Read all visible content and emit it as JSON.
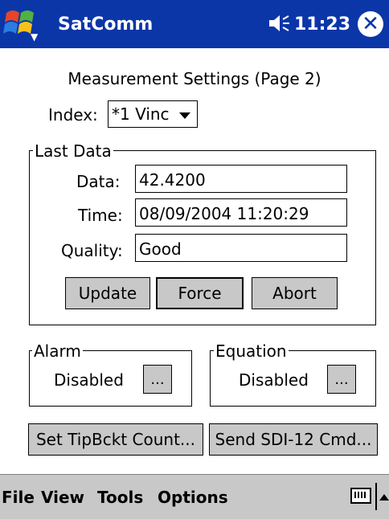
{
  "titlebar": {
    "app_title": "SatComm",
    "time": "11:23",
    "close": "✕"
  },
  "heading": "Measurement Settings (Page 2)",
  "index": {
    "label": "Index:",
    "value": "*1 Vinc"
  },
  "last_data": {
    "legend": "Last Data",
    "data_label": "Data:",
    "data_value": "42.4200",
    "time_label": "Time:",
    "time_value": "08/09/2004 11:20:29",
    "quality_label": "Quality:",
    "quality_value": "Good",
    "buttons": {
      "update": "Update",
      "force": "Force",
      "abort": "Abort"
    }
  },
  "alarm": {
    "legend": "Alarm",
    "status": "Disabled",
    "button": "..."
  },
  "equation": {
    "legend": "Equation",
    "status": "Disabled",
    "button": "..."
  },
  "actions": {
    "tipbucket": "Set TipBckt Count...",
    "sdi12": "Send SDI-12 Cmd..."
  },
  "menubar": {
    "file": "File",
    "view": "View",
    "tools": "Tools",
    "options": "Options"
  },
  "icons": {
    "start": "windows-flag-icon",
    "volume": "speaker-icon",
    "close": "close-icon",
    "keyboard": "keyboard-icon",
    "arrow": "up-arrow-icon"
  }
}
